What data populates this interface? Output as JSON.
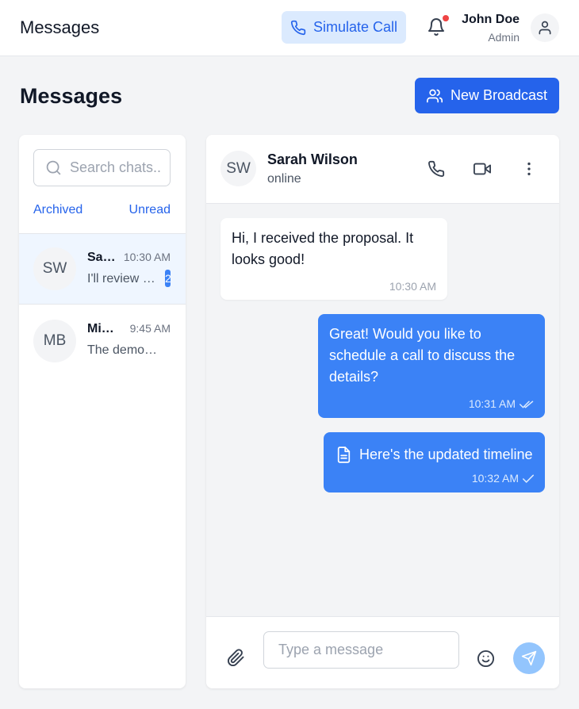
{
  "header": {
    "app_title": "Messages",
    "simulate_call_label": "Simulate Call",
    "user": {
      "name": "John Doe",
      "role": "Admin"
    }
  },
  "page": {
    "title": "Messages",
    "new_broadcast_label": "New Broadcast"
  },
  "sidebar": {
    "search_placeholder": "Search chats..",
    "filters": {
      "archived": "Archived",
      "unread": "Unread"
    },
    "chats": [
      {
        "initials": "SW",
        "name": "Sarah Wilson",
        "time": "10:30 AM",
        "preview": "I'll review the proposal",
        "unread": "2",
        "active": true
      },
      {
        "initials": "MB",
        "name": "Michael Brown",
        "time": "9:45 AM",
        "preview": "The demo went well",
        "unread": "",
        "active": false
      }
    ]
  },
  "conversation": {
    "contact": {
      "initials": "SW",
      "name": "Sarah Wilson",
      "status": "online"
    },
    "messages": [
      {
        "direction": "incoming",
        "text": "Hi, I received the proposal. It looks good!",
        "time": "10:30 AM"
      },
      {
        "direction": "outgoing",
        "text": "Great! Would you like to schedule a call to discuss the details?",
        "time": "10:31 AM",
        "receipt": "double-check-icon"
      },
      {
        "direction": "outgoing",
        "type": "file",
        "text": "Here's the updated timeline",
        "time": "10:32 AM",
        "receipt": "check-icon"
      }
    ],
    "composer": {
      "placeholder": "Type a message"
    }
  },
  "colors": {
    "accent": "#2563eb",
    "outgoing_bubble": "#3b82f6",
    "notification_dot": "#ef4444",
    "send_button": "#93c5fd"
  }
}
